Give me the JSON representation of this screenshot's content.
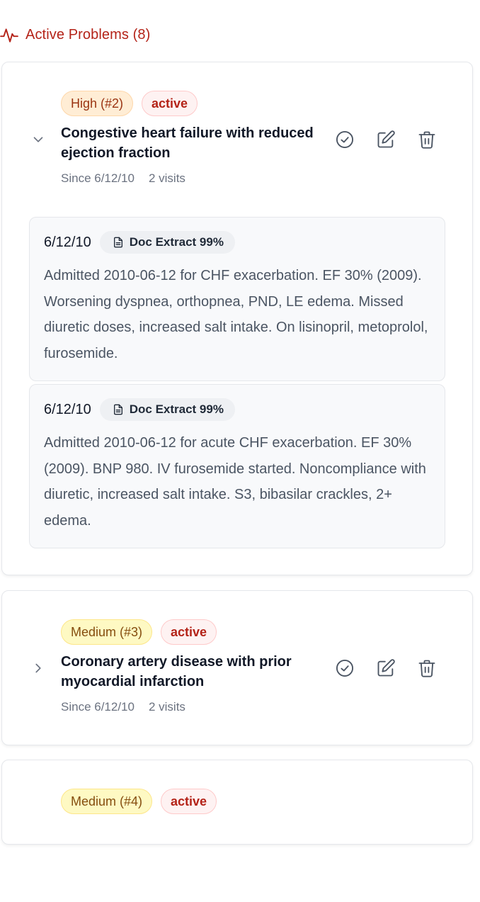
{
  "section": {
    "title": "Active Problems (8)",
    "icon": "activity-pulse-icon",
    "color": "#b42318"
  },
  "problems": [
    {
      "priority": "High (#2)",
      "status": "active",
      "title": "Congestive heart failure with reduced ejection fraction",
      "since": "Since 6/12/10",
      "visits": "2 visits",
      "expanded": true,
      "notes": [
        {
          "date": "6/12/10",
          "source": "Doc Extract 99%",
          "text": "Admitted 2010-06-12 for CHF exacerbation. EF 30% (2009). Worsening dyspnea, orthopnea, PND, LE edema. Missed diuretic doses, increased salt intake. On lisinopril, metoprolol, furosemide."
        },
        {
          "date": "6/12/10",
          "source": "Doc Extract 99%",
          "text": "Admitted 2010-06-12 for acute CHF exacerbation. EF 30% (2009). BNP 980. IV furosemide started. Noncompliance with diuretic, increased salt intake. S3, bibasilar crackles, 2+ edema."
        }
      ]
    },
    {
      "priority": "Medium (#3)",
      "status": "active",
      "title": "Coronary artery disease with prior myocardial infarction",
      "since": "Since 6/12/10",
      "visits": "2 visits",
      "expanded": false
    },
    {
      "priority": "Medium (#4)",
      "status": "active"
    }
  ],
  "actions": {
    "resolve_icon": "check-circle-icon",
    "edit_icon": "edit-icon",
    "delete_icon": "trash-icon"
  },
  "colors": {
    "high_badge_bg": "#ffedd5",
    "medium_badge_bg": "#fef9c3",
    "status_badge_text": "#b42318",
    "note_bg": "#f8f9fb"
  }
}
